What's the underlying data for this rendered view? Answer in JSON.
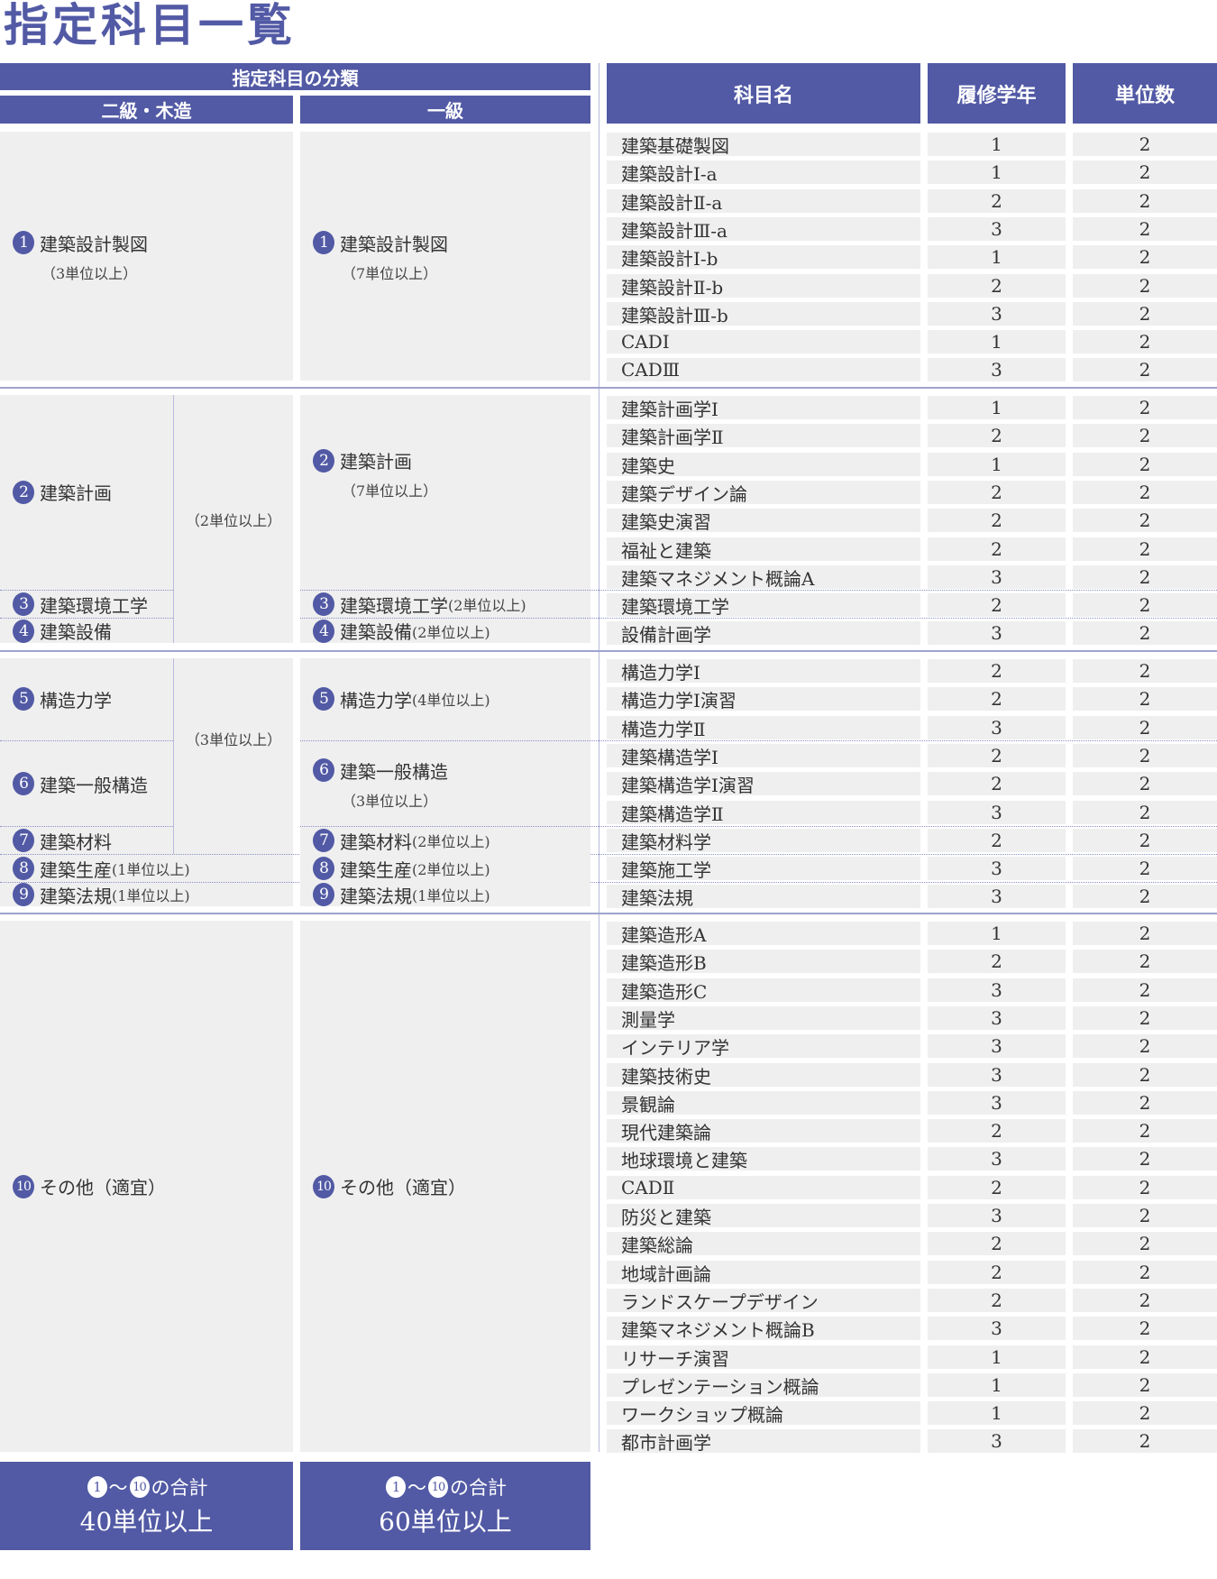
{
  "title": "指定科目一覧",
  "header": {
    "classification": "指定科目の分類",
    "grade2": "二級・木造",
    "grade1": "一級",
    "subject": "科目名",
    "year": "履修学年",
    "credits": "単位数"
  },
  "colors": {
    "accent": "#525aa5",
    "cell": "#efefef"
  },
  "categories": {
    "left": [
      {
        "num": "1",
        "name": "建築設計製図",
        "note": "（3単位以上）"
      },
      {
        "num": "2",
        "name": "建築計画"
      },
      {
        "num": "3",
        "name": "建築環境工学"
      },
      {
        "num": "4",
        "name": "建築設備"
      },
      {
        "num": "5",
        "name": "構造力学"
      },
      {
        "num": "6",
        "name": "建築一般構造"
      },
      {
        "num": "7",
        "name": "建築材料"
      },
      {
        "num": "8",
        "name": "建築生産",
        "note": "(1単位以上)"
      },
      {
        "num": "9",
        "name": "建築法規",
        "note": "(1単位以上)"
      },
      {
        "num": "10",
        "name": "その他（適宜）"
      }
    ],
    "left_groups": {
      "g234": "（2単位以上）",
      "g567": "（3単位以上）"
    },
    "right": [
      {
        "num": "1",
        "name": "建築設計製図",
        "note": "（7単位以上）"
      },
      {
        "num": "2",
        "name": "建築計画",
        "note": "（7単位以上）"
      },
      {
        "num": "3",
        "name": "建築環境工学",
        "note": "(2単位以上)"
      },
      {
        "num": "4",
        "name": "建築設備",
        "note": "(2単位以上)"
      },
      {
        "num": "5",
        "name": "構造力学",
        "note": "(4単位以上)"
      },
      {
        "num": "6",
        "name": "建築一般構造",
        "note": "（3単位以上）"
      },
      {
        "num": "7",
        "name": "建築材料",
        "note": "(2単位以上)"
      },
      {
        "num": "8",
        "name": "建築生産",
        "note": "(2単位以上)"
      },
      {
        "num": "9",
        "name": "建築法規",
        "note": "(1単位以上)"
      },
      {
        "num": "10",
        "name": "その他（適宜）"
      }
    ]
  },
  "totals": {
    "left": {
      "from": "1",
      "to": "10",
      "label": "の合計",
      "value": "40単位以上"
    },
    "right": {
      "from": "1",
      "to": "10",
      "label": "の合計",
      "value": "60単位以上"
    },
    "separator": "〜"
  },
  "subjects": [
    {
      "name": "建築基礎製図",
      "year": "1",
      "credits": "2"
    },
    {
      "name": "建築設計Ⅰ-a",
      "year": "1",
      "credits": "2"
    },
    {
      "name": "建築設計Ⅱ-a",
      "year": "2",
      "credits": "2"
    },
    {
      "name": "建築設計Ⅲ-a",
      "year": "3",
      "credits": "2"
    },
    {
      "name": "建築設計Ⅰ-b",
      "year": "1",
      "credits": "2"
    },
    {
      "name": "建築設計Ⅱ-b",
      "year": "2",
      "credits": "2"
    },
    {
      "name": "建築設計Ⅲ-b",
      "year": "3",
      "credits": "2"
    },
    {
      "name": "CADⅠ",
      "year": "1",
      "credits": "2"
    },
    {
      "name": "CADⅢ",
      "year": "3",
      "credits": "2"
    },
    {
      "name": "建築計画学Ⅰ",
      "year": "1",
      "credits": "2"
    },
    {
      "name": "建築計画学Ⅱ",
      "year": "2",
      "credits": "2"
    },
    {
      "name": "建築史",
      "year": "1",
      "credits": "2"
    },
    {
      "name": "建築デザイン論",
      "year": "2",
      "credits": "2"
    },
    {
      "name": "建築史演習",
      "year": "2",
      "credits": "2"
    },
    {
      "name": "福祉と建築",
      "year": "2",
      "credits": "2"
    },
    {
      "name": "建築マネジメント概論A",
      "year": "3",
      "credits": "2"
    },
    {
      "name": "建築環境工学",
      "year": "2",
      "credits": "2"
    },
    {
      "name": "設備計画学",
      "year": "3",
      "credits": "2"
    },
    {
      "name": "構造力学Ⅰ",
      "year": "2",
      "credits": "2"
    },
    {
      "name": "構造力学Ⅰ演習",
      "year": "2",
      "credits": "2"
    },
    {
      "name": "構造力学Ⅱ",
      "year": "3",
      "credits": "2"
    },
    {
      "name": "建築構造学Ⅰ",
      "year": "2",
      "credits": "2"
    },
    {
      "name": "建築構造学Ⅰ演習",
      "year": "2",
      "credits": "2"
    },
    {
      "name": "建築構造学Ⅱ",
      "year": "3",
      "credits": "2"
    },
    {
      "name": "建築材料学",
      "year": "2",
      "credits": "2"
    },
    {
      "name": "建築施工学",
      "year": "3",
      "credits": "2"
    },
    {
      "name": "建築法規",
      "year": "3",
      "credits": "2"
    },
    {
      "name": "建築造形A",
      "year": "1",
      "credits": "2"
    },
    {
      "name": "建築造形B",
      "year": "2",
      "credits": "2"
    },
    {
      "name": "建築造形C",
      "year": "3",
      "credits": "2"
    },
    {
      "name": "測量学",
      "year": "3",
      "credits": "2"
    },
    {
      "name": "インテリア学",
      "year": "3",
      "credits": "2"
    },
    {
      "name": "建築技術史",
      "year": "3",
      "credits": "2"
    },
    {
      "name": "景観論",
      "year": "3",
      "credits": "2"
    },
    {
      "name": "現代建築論",
      "year": "2",
      "credits": "2"
    },
    {
      "name": "地球環境と建築",
      "year": "3",
      "credits": "2"
    },
    {
      "name": "CADⅡ",
      "year": "2",
      "credits": "2"
    },
    {
      "name": "防災と建築",
      "year": "3",
      "credits": "2"
    },
    {
      "name": "建築総論",
      "year": "2",
      "credits": "2"
    },
    {
      "name": "地域計画論",
      "year": "2",
      "credits": "2"
    },
    {
      "name": "ランドスケープデザイン",
      "year": "2",
      "credits": "2"
    },
    {
      "name": "建築マネジメント概論B",
      "year": "3",
      "credits": "2"
    },
    {
      "name": "リサーチ演習",
      "year": "1",
      "credits": "2"
    },
    {
      "name": "プレゼンテーション概論",
      "year": "1",
      "credits": "2"
    },
    {
      "name": "ワークショップ概論",
      "year": "1",
      "credits": "2"
    },
    {
      "name": "都市計画学",
      "year": "3",
      "credits": "2"
    }
  ]
}
